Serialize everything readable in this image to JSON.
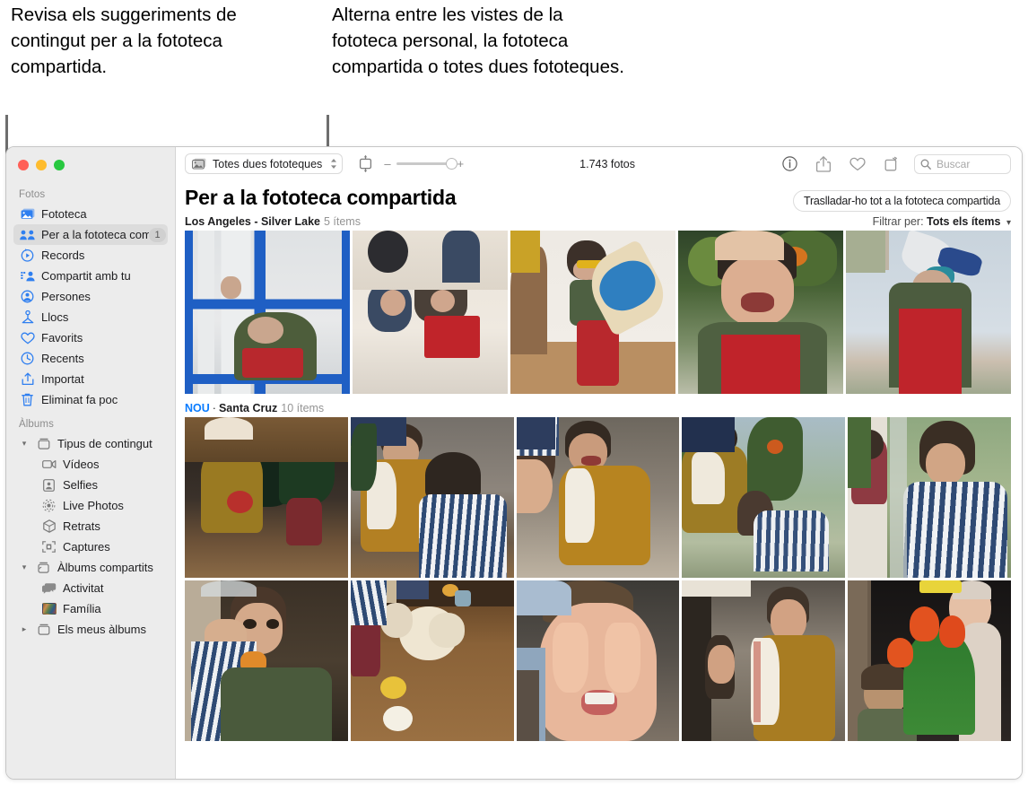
{
  "callouts": {
    "left": "Revisa els suggeriments de contingut per a la fototeca compartida.",
    "right": "Alterna entre les vistes de la fototeca personal, la fototeca compartida o totes dues fototeques."
  },
  "window": {
    "traffic_lights": [
      "close",
      "minimize",
      "zoom"
    ],
    "colors": {
      "close": "#ff5f57",
      "minimize": "#febc2e",
      "zoom": "#28c840"
    }
  },
  "sidebar": {
    "sections": [
      {
        "title": "Fotos",
        "items": [
          {
            "label": "Fototeca",
            "icon": "photos-library-icon",
            "selected": false,
            "badge": ""
          },
          {
            "label": "Per a la fototeca comp…",
            "icon": "shared-library-people-icon",
            "selected": true,
            "badge": "1"
          },
          {
            "label": "Records",
            "icon": "memories-play-icon",
            "selected": false,
            "badge": ""
          },
          {
            "label": "Compartit amb tu",
            "icon": "shared-with-you-icon",
            "selected": false,
            "badge": ""
          },
          {
            "label": "Persones",
            "icon": "people-person-icon",
            "selected": false,
            "badge": ""
          },
          {
            "label": "Llocs",
            "icon": "places-pin-icon",
            "selected": false,
            "badge": ""
          },
          {
            "label": "Favorits",
            "icon": "heart-icon",
            "selected": false,
            "badge": ""
          },
          {
            "label": "Recents",
            "icon": "clock-icon",
            "selected": false,
            "badge": ""
          },
          {
            "label": "Importat",
            "icon": "import-tray-icon",
            "selected": false,
            "badge": ""
          },
          {
            "label": "Eliminat fa poc",
            "icon": "trash-icon",
            "selected": false,
            "badge": ""
          }
        ]
      },
      {
        "title": "Àlbums",
        "items": [
          {
            "label": "Tipus de contingut",
            "icon": "album-box-icon",
            "selected": false,
            "badge": "",
            "disclosure": "expanded",
            "indent": 0
          },
          {
            "label": "Vídeos",
            "icon": "video-icon",
            "selected": false,
            "badge": "",
            "disclosure": "",
            "indent": 1
          },
          {
            "label": "Selfies",
            "icon": "selfie-icon",
            "selected": false,
            "badge": "",
            "disclosure": "",
            "indent": 1
          },
          {
            "label": "Live Photos",
            "icon": "live-photo-icon",
            "selected": false,
            "badge": "",
            "disclosure": "",
            "indent": 1
          },
          {
            "label": "Retrats",
            "icon": "portrait-cube-icon",
            "selected": false,
            "badge": "",
            "disclosure": "",
            "indent": 1
          },
          {
            "label": "Captures",
            "icon": "screenshot-icon",
            "selected": false,
            "badge": "",
            "disclosure": "",
            "indent": 1
          },
          {
            "label": "Àlbums compartits",
            "icon": "shared-album-icon",
            "selected": false,
            "badge": "",
            "disclosure": "expanded",
            "indent": 0
          },
          {
            "label": "Activitat",
            "icon": "activity-bubbles-icon",
            "selected": false,
            "badge": "",
            "disclosure": "",
            "indent": 1
          },
          {
            "label": "Família",
            "icon": "album-thumbnail-icon",
            "selected": false,
            "badge": "",
            "disclosure": "",
            "indent": 1
          },
          {
            "label": "Els meus àlbums",
            "icon": "album-box-icon",
            "selected": false,
            "badge": "",
            "disclosure": "collapsed",
            "indent": 0
          }
        ]
      }
    ]
  },
  "toolbar": {
    "library_popup_label": "Totes dues fototeques",
    "library_popup_icon": "photos-library-icon",
    "aspect_button_icon": "aspect-ratio-icon",
    "zoom_minus": "–",
    "zoom_plus": "+",
    "photo_count": "1.743 fotos",
    "right_buttons": [
      {
        "icon": "info-icon",
        "label": "Informació"
      },
      {
        "icon": "share-icon",
        "label": "Compartir"
      },
      {
        "icon": "heart-icon",
        "label": "Favorit"
      },
      {
        "icon": "rotate-icon",
        "label": "Girar"
      }
    ],
    "search": {
      "icon": "search-icon",
      "placeholder": "Buscar",
      "value": ""
    }
  },
  "content": {
    "title": "Per a la fototeca compartida",
    "move_all_button": "Traslladar-ho tot a la fototeca compartida",
    "filter": {
      "label": "Filtrar per:",
      "value": "Tots els ítems",
      "icon": "chevron-down-icon"
    },
    "sections": [
      {
        "badge": "",
        "place": "Los Angeles - Silver Lake",
        "count": "5 ítems"
      },
      {
        "badge": "NOU",
        "place": "Santa Cruz",
        "count": "10 ítems"
      }
    ]
  },
  "photos": {
    "section1_row1": [
      "child-at-blue-window",
      "two-children-on-floor-with-red-box",
      "child-playing-blue-guitar",
      "smiling-child-outdoors-red-overalls",
      "child-with-paper-megaphone-sky"
    ],
    "section2_row1": [
      "woman-cooking-with-plants",
      "woman-and-child-kneading-dough",
      "smiling-woman-at-table",
      "children-playing-by-window",
      "two-boys-by-glass-door"
    ],
    "section2_row2": [
      "child-eating-orange",
      "hands-kneading-flour-dough",
      "child-covering-face-with-floury-hands",
      "woman-laughing-with-towel",
      "child-and-baby-with-tulips"
    ]
  }
}
